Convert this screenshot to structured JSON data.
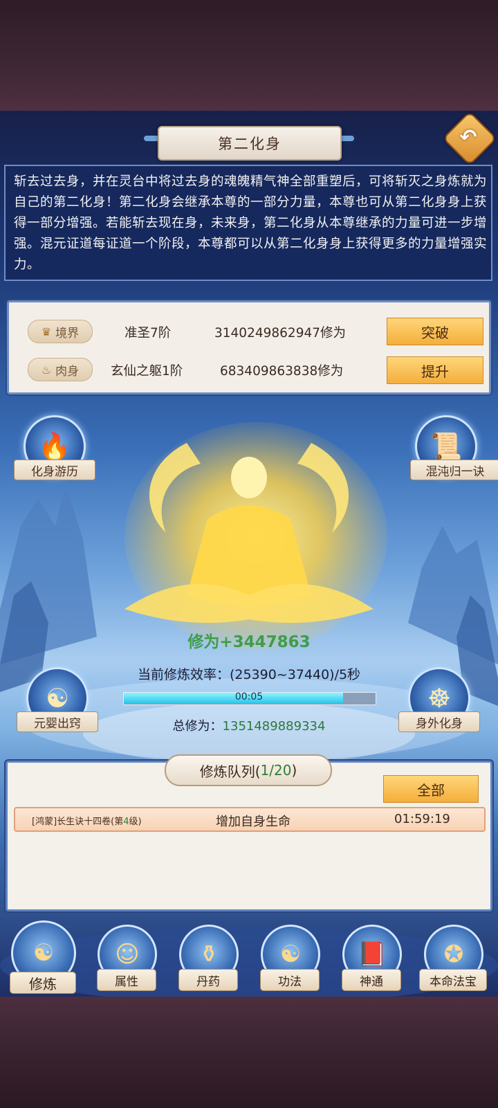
{
  "title": "第二化身",
  "description": "斩去过去身，并在灵台中将过去身的魂魄精气神全部重塑后，可将斩灭之身炼就为自己的第二化身！第二化身会继承本尊的一部分力量，本尊也可从第二化身身上获得一部分增强。若能斩去现在身，未来身，第二化身从本尊继承的力量可进一步增强。混元证道每证道一个阶段，本尊都可以从第二化身身上获得更多的力量增强实力。",
  "stats": [
    {
      "label": "境界",
      "icon": "crown-icon",
      "level": "准圣7阶",
      "cultivation": "3140249862947修为",
      "button": "突破"
    },
    {
      "label": "肉身",
      "icon": "flame-icon",
      "level": "玄仙之躯1阶",
      "cultivation": "683409863838修为",
      "button": "提升"
    }
  ],
  "features": {
    "travel": "化身游历",
    "chaos_art": "混沌归一诀",
    "nascent_soul": "元婴出窍",
    "external_avatar": "身外化身"
  },
  "cultivation": {
    "gain": "修为+3447863",
    "rate": "当前修炼效率：(25390~37440)/5秒",
    "timer": "00:05",
    "progress": 0.87,
    "total_label": "总修为：",
    "total_value": "1351489889334"
  },
  "queue": {
    "title_prefix": "修炼队列(",
    "count": "1/20",
    "title_suffix": " )",
    "all_button": "全部",
    "item": {
      "name_prefix": "[鸿蒙]长生诀十四卷(第",
      "name_level": "4",
      "name_suffix": "级)",
      "effect": "增加自身生命",
      "time": "01:59:19"
    }
  },
  "nav": [
    "修炼",
    "属性",
    "丹药",
    "功法",
    "神通",
    "本命法宝"
  ],
  "colors": {
    "accent_gold": "#f4ae3c",
    "panel_blue": "#16285c",
    "gain_green": "#3f9d4a"
  }
}
